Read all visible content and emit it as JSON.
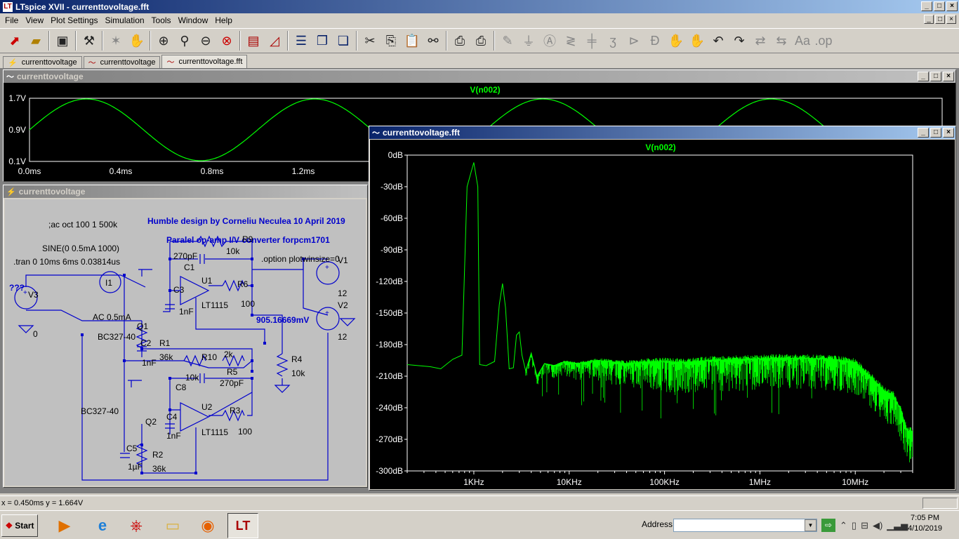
{
  "window": {
    "title": "LTspice XVII - currenttovoltage.fft",
    "controls": [
      "_",
      "□",
      "×"
    ]
  },
  "menu": {
    "items": [
      "File",
      "View",
      "Plot Settings",
      "Simulation",
      "Tools",
      "Window",
      "Help"
    ]
  },
  "tabs": [
    {
      "label": "currenttovoltage"
    },
    {
      "label": "currenttovoltage"
    },
    {
      "label": "currenttovoltage.fft"
    }
  ],
  "waveform_window": {
    "title": "currenttovoltage",
    "trace_label": "V(n002)",
    "y_ticks": [
      "1.7V",
      "0.9V",
      "0.1V"
    ],
    "x_ticks": [
      "0.0ms",
      "0.4ms",
      "0.8ms",
      "1.2ms"
    ],
    "trace_color": "#00ff00"
  },
  "schematic_window": {
    "title": "currenttovoltage",
    "texts": {
      "ac": ";ac oct 100 1 500k",
      "sine": "SINE(0 0.5mA 1000)",
      "tran": ".tran 0 10ms 6ms 0.03814us",
      "credit": "Humble design by Corneliu Neculea 10 April 2019",
      "desc": "Paralel op-amp I/V converter  forpcm1701",
      "option": ".option plotwinsize=0",
      "probe": "905.16669mV",
      "qqq": "???",
      "ac_src": "AC 0.5mA"
    },
    "labels": {
      "V3": "V3",
      "I1": "I1",
      "Q1": "Q1",
      "Q2": "Q2",
      "V1": "V1",
      "V2": "V2",
      "U1": "U1",
      "U2": "U2",
      "R1": "R1",
      "R2": "R2",
      "R3": "R3",
      "R4": "R4",
      "R5": "R5",
      "R6": "R6",
      "R9": "R9",
      "R10": "R10",
      "C1": "C1",
      "C2": "C2",
      "C3": "C3",
      "C4": "C4",
      "C5": "C5",
      "C8": "C8",
      "v_r9": "10k",
      "v_c1": "270pF",
      "v_r6": "100",
      "v_c3": "1nF",
      "v_u1": "LT1115",
      "v_q1": "BC327-40",
      "v_r1": "36k",
      "v_c2": "1nF",
      "v_r10": "10k",
      "v_r5": "2k",
      "v_c8": "270pF",
      "v_r4": "10k",
      "v_q2": "BC327-40",
      "v_c4": "1nF",
      "v_u2": "LT1115",
      "v_r3": "100",
      "v_c5": "1µF",
      "v_r2": "36k",
      "v_v1": "12",
      "v_v2": "12",
      "zero": "0"
    }
  },
  "fft_window": {
    "title": "currenttovoltage.fft",
    "trace_label": "V(n002)",
    "trace_color": "#00ff00"
  },
  "chart_data": {
    "type": "line",
    "title": "V(n002)",
    "xlabel": "",
    "ylabel": "",
    "x_scale": "log",
    "xlim": [
      200,
      40000000
    ],
    "ylim": [
      -300,
      0
    ],
    "x_tick_labels": [
      "1KHz",
      "10KHz",
      "100KHz",
      "1MHz",
      "10MHz"
    ],
    "x_tick_values": [
      1000,
      10000,
      100000,
      1000000,
      10000000
    ],
    "y_tick_labels": [
      "0dB",
      "-30dB",
      "-60dB",
      "-90dB",
      "-120dB",
      "-150dB",
      "-180dB",
      "-210dB",
      "-240dB",
      "-270dB",
      "-300dB"
    ],
    "y_tick_values": [
      0,
      -30,
      -60,
      -90,
      -120,
      -150,
      -180,
      -210,
      -240,
      -270,
      -300
    ],
    "series": [
      {
        "values_desc": "frequency (Hz), magnitude (dB)",
        "points": [
          [
            200,
            -199
          ],
          [
            350,
            -201
          ],
          [
            450,
            -203
          ],
          [
            600,
            -194
          ],
          [
            750,
            -190
          ],
          [
            850,
            -30
          ],
          [
            1000,
            -7
          ],
          [
            1100,
            -30
          ],
          [
            1150,
            -199
          ],
          [
            1350,
            -200
          ],
          [
            1650,
            -196
          ],
          [
            1850,
            -142
          ],
          [
            2000,
            -122
          ],
          [
            2150,
            -145
          ],
          [
            2350,
            -203
          ],
          [
            2600,
            -202
          ],
          [
            2800,
            -171
          ],
          [
            3000,
            -168
          ],
          [
            3200,
            -190
          ],
          [
            3500,
            -205
          ],
          [
            4000,
            -188
          ],
          [
            4600,
            -210
          ],
          [
            5500,
            -198
          ],
          [
            7000,
            -200
          ],
          [
            9000,
            -196
          ],
          [
            12000,
            -198
          ],
          [
            20000,
            -195
          ],
          [
            40000,
            -198
          ],
          [
            80000,
            -196
          ],
          [
            150000,
            -197
          ],
          [
            300000,
            -195
          ],
          [
            700000,
            -194
          ],
          [
            1500000,
            -193
          ],
          [
            3000000,
            -193
          ],
          [
            6000000,
            -194
          ],
          [
            10000000,
            -197
          ],
          [
            15000000,
            -212
          ],
          [
            20000000,
            -224
          ],
          [
            25000000,
            -228
          ],
          [
            30000000,
            -242
          ],
          [
            35000000,
            -262
          ]
        ]
      }
    ]
  },
  "statusbar": {
    "coords": "x = 0.450ms   y = 1.664V"
  },
  "taskbar": {
    "start_label": "Start",
    "address_label": "Address",
    "time": "7:05 PM",
    "date": "4/10/2019"
  }
}
